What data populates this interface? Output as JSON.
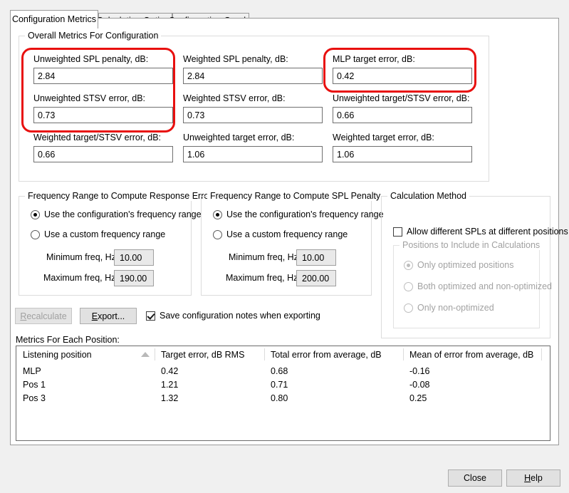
{
  "window": {
    "background_color": "#f0f0f0",
    "accent_color": "#e8100f"
  },
  "tabs": [
    {
      "label": "Configuration Metrics",
      "active": true
    },
    {
      "label": "Calculation Options",
      "active": false
    },
    {
      "label": "Configuration Graphs",
      "active": false
    }
  ],
  "overall_metrics": {
    "title": "Overall Metrics For Configuration",
    "fields": [
      {
        "label": "Unweighted SPL penalty, dB:",
        "value": "2.84"
      },
      {
        "label": "Weighted SPL penalty, dB:",
        "value": "2.84"
      },
      {
        "label": "MLP target error, dB:",
        "value": "0.42"
      },
      {
        "label": "Unweighted STSV error, dB:",
        "value": "0.73"
      },
      {
        "label": "Weighted STSV error, dB:",
        "value": "0.73"
      },
      {
        "label": "Unweighted target/STSV error, dB:",
        "value": "0.66"
      },
      {
        "label": "Weighted target/STSV error, dB:",
        "value": "0.66"
      },
      {
        "label": "Unweighted target error, dB:",
        "value": "1.06"
      },
      {
        "label": "Weighted target error, dB:",
        "value": "1.06"
      }
    ]
  },
  "response_errors": {
    "title": "Frequency Range to Compute Response Errors",
    "option_config_range": "Use the configuration's frequency range",
    "option_custom_range": "Use a custom frequency range",
    "selected": "config",
    "min_label": "Minimum freq, Hz:",
    "min_value": "10.00",
    "max_label": "Maximum freq, Hz:",
    "max_value": "190.00"
  },
  "spl_penalty": {
    "title": "Frequency Range to Compute SPL Penalty",
    "option_config_range": "Use the configuration's frequency range",
    "option_custom_range": "Use a custom frequency range",
    "selected": "config",
    "min_label": "Minimum freq, Hz:",
    "min_value": "10.00",
    "max_label": "Maximum freq, Hz:",
    "max_value": "200.00"
  },
  "calculation_method": {
    "title": "Calculation Method",
    "allow_different_spls_label": "Allow different SPLs at different positions",
    "allow_different_spls_checked": false,
    "positions_group_title": "Positions to Include in Calculations",
    "positions_disabled": true,
    "positions_options": [
      {
        "label": "Only optimized positions",
        "selected": true
      },
      {
        "label": "Both optimized and non-optimized",
        "selected": false
      },
      {
        "label": "Only non-optimized",
        "selected": false
      }
    ]
  },
  "actions": {
    "recalculate_label": "Recalculate",
    "recalculate_mnemonic": "R",
    "recalculate_disabled": true,
    "export_label": "Export...",
    "export_mnemonic": "E",
    "save_notes_label": "Save configuration notes when exporting",
    "save_notes_checked": true
  },
  "metrics_table": {
    "caption": "Metrics For Each Position:",
    "sort_column": 0,
    "sort_direction": "ascending",
    "columns": [
      "Listening position",
      "Target error, dB RMS",
      "Total error from average, dB",
      "Mean of error from average, dB"
    ],
    "rows": [
      [
        "MLP",
        "0.42",
        "0.68",
        "-0.16"
      ],
      [
        "Pos 1",
        "1.21",
        "0.71",
        "-0.08"
      ],
      [
        "Pos 3",
        "1.32",
        "0.80",
        "0.25"
      ]
    ]
  },
  "footer": {
    "close_label": "Close",
    "help_label": "Help",
    "help_mnemonic": "H"
  },
  "annotations": [
    {
      "name": "unweighted-metrics-highlight"
    },
    {
      "name": "mlp-target-error-highlight"
    }
  ]
}
